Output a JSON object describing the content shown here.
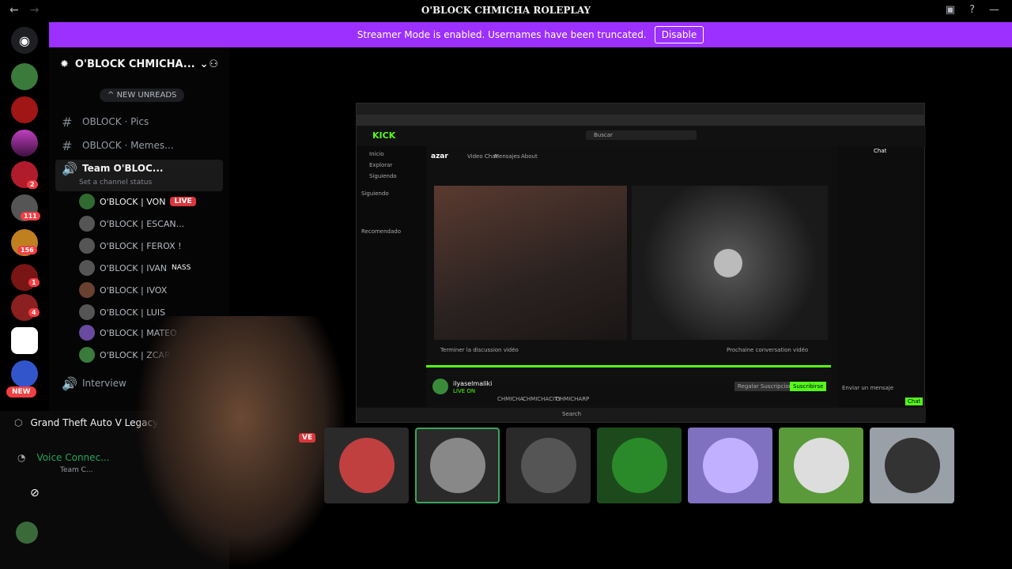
{
  "titlebar": {
    "title": "O'BLOCK CHMICHA ROLEPLAY",
    "nav_back": "←",
    "nav_forward": "→"
  },
  "banner": {
    "text": "Streamer Mode is enabled. Usernames have been truncated.",
    "button": "Disable",
    "color": "#9b30ff"
  },
  "servers": {
    "badges": [
      "2",
      "111",
      "156",
      "1",
      "4"
    ],
    "new_label": "NEW"
  },
  "channel_sidebar": {
    "server_name": "O'BLOCK CHMICHA...",
    "new_unreads": "NEW UNREADS",
    "channels": [
      {
        "name": "OBLOCK · Pics"
      },
      {
        "name": "OBLOCK · Memes..."
      }
    ],
    "voice_channel": {
      "name": "Team O'BLOC...",
      "status": "Set a channel status"
    },
    "voice_users": [
      {
        "name": "O'BLOCK | VON",
        "live": "LIVE"
      },
      {
        "name": "O'BLOCK | ESCAN..."
      },
      {
        "name": "O'BLOCK | FEROX !"
      },
      {
        "name": "O'BLOCK | IVAN",
        "tag": "NASS"
      },
      {
        "name": "O'BLOCK | IVOX"
      },
      {
        "name": "O'BLOCK | LUIS"
      },
      {
        "name": "O'BLOCK | MATEO"
      },
      {
        "name": "O'BLOCK | ZCAR"
      }
    ],
    "interview_channel": "Interview"
  },
  "bottom_panel": {
    "activity": "Grand Theft Auto V Legacy",
    "voice_status": "Voice Connec...",
    "voice_channel": "Team C..."
  },
  "screenshare": {
    "kick_logo": "KICK",
    "search_placeholder": "Buscar",
    "sidebar_items": [
      "Inicio",
      "Explorar",
      "Siguiendo"
    ],
    "section_following": "Siguiendo",
    "section_recommended": "Recomendado",
    "inner_tabs": [
      "Video Chat",
      "Mensajes",
      "About"
    ],
    "inner_brand": "azar",
    "chat_title": "Chat",
    "streamer": "ilyaselmaliki",
    "stream_sub": "LIVE ON",
    "tags": [
      "CHMICHA",
      "CHMICHACITY",
      "CHMICHARP"
    ],
    "subscribe_button": "Regalar Suscripciones",
    "follow_button": "Suscribirse",
    "chat_placeholder": "Enviar un mensaje",
    "chat_send": "Chat",
    "taskbar_search": "Search",
    "video_caption": "Terminer la discussion vidéo",
    "next_caption": "Prochaine conversation vidéo"
  },
  "participant_tiles": [
    {
      "label": "VE"
    },
    {
      "label": ""
    },
    {
      "label": ""
    },
    {
      "label": ""
    },
    {
      "label": ""
    },
    {
      "label": ""
    },
    {
      "label": ""
    }
  ]
}
